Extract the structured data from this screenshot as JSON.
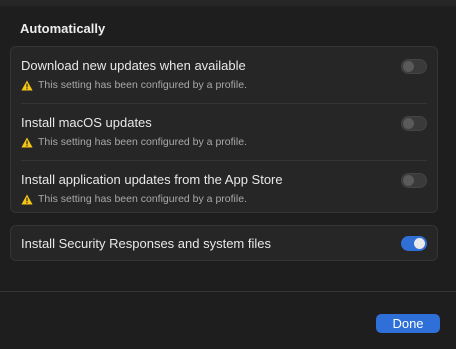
{
  "section_title": "Automatically",
  "warning_icon": "warning-triangle-icon",
  "rows": [
    {
      "label": "Download new updates when available",
      "note": "This setting has been configured by a profile.",
      "enabled": false
    },
    {
      "label": "Install macOS updates",
      "note": "This setting has been configured by a profile.",
      "enabled": false
    },
    {
      "label": "Install application updates from the App Store",
      "note": "This setting has been configured by a profile.",
      "enabled": false
    }
  ],
  "security_row": {
    "label": "Install Security Responses and system files",
    "enabled": true
  },
  "done_label": "Done",
  "colors": {
    "accent": "#2e6fd8",
    "warning": "#f5c518",
    "background": "#1e1e1e",
    "group_background": "#262626"
  }
}
